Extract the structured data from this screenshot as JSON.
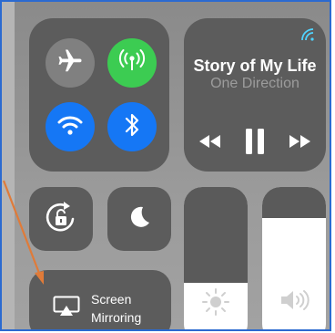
{
  "music": {
    "title": "Story of My Life",
    "artist": "One Direction"
  },
  "screen_mirroring": {
    "line1": "Screen",
    "line2": "Mirroring"
  },
  "sliders": {
    "brightness_level": 0.38,
    "volume_level": 0.8
  },
  "colors": {
    "cellular_active": "#3ccc52",
    "wifi_active": "#1577f5",
    "bluetooth_active": "#1577f5",
    "airplay_accent": "#4fd3ff",
    "annotation_arrow": "#e07b39",
    "frame_border": "#2b6ad0"
  },
  "icons": {
    "airplane": "airplane-icon",
    "cellular": "cellular-data-icon",
    "wifi": "wifi-icon",
    "bluetooth": "bluetooth-icon",
    "airplay": "airplay-icon",
    "rewind": "rewind-icon",
    "pause": "pause-icon",
    "fast_forward": "fast-forward-icon",
    "rotation_lock": "rotation-lock-icon",
    "do_not_disturb": "moon-icon",
    "screen_mirroring": "screen-mirroring-icon",
    "brightness": "sun-icon",
    "volume": "speaker-icon"
  }
}
